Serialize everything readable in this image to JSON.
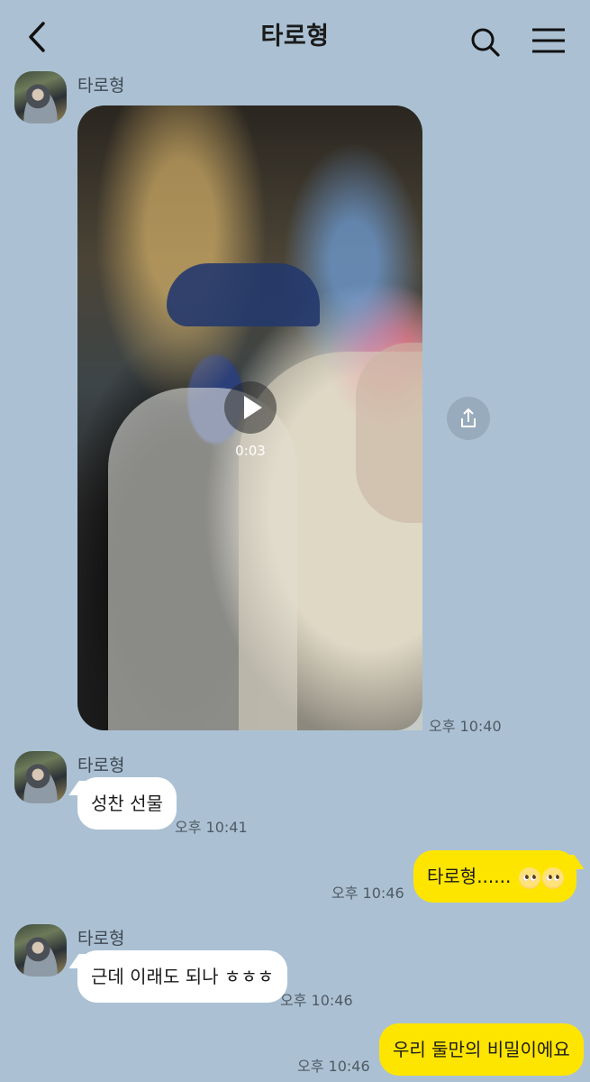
{
  "header": {
    "title": "타로형"
  },
  "messages": {
    "m1": {
      "sender": "타로형",
      "video_duration": "0:03",
      "time": "오후 10:40"
    },
    "m2": {
      "sender": "타로형",
      "text": "성찬 선물",
      "time": "오후 10:41"
    },
    "m3": {
      "text": "타로형......",
      "emoji": "pleading-face x2",
      "time": "오후 10:46"
    },
    "m4": {
      "sender": "타로형",
      "text": "근데 이래도 되나 ㅎㅎㅎ",
      "time": "오후 10:46"
    },
    "m5": {
      "text": "우리 둘만의 비밀이에요",
      "time": "오후 10:46"
    }
  },
  "colors": {
    "background": "#abc1d3",
    "incoming_bubble": "#ffffff",
    "outgoing_bubble": "#fee500"
  }
}
